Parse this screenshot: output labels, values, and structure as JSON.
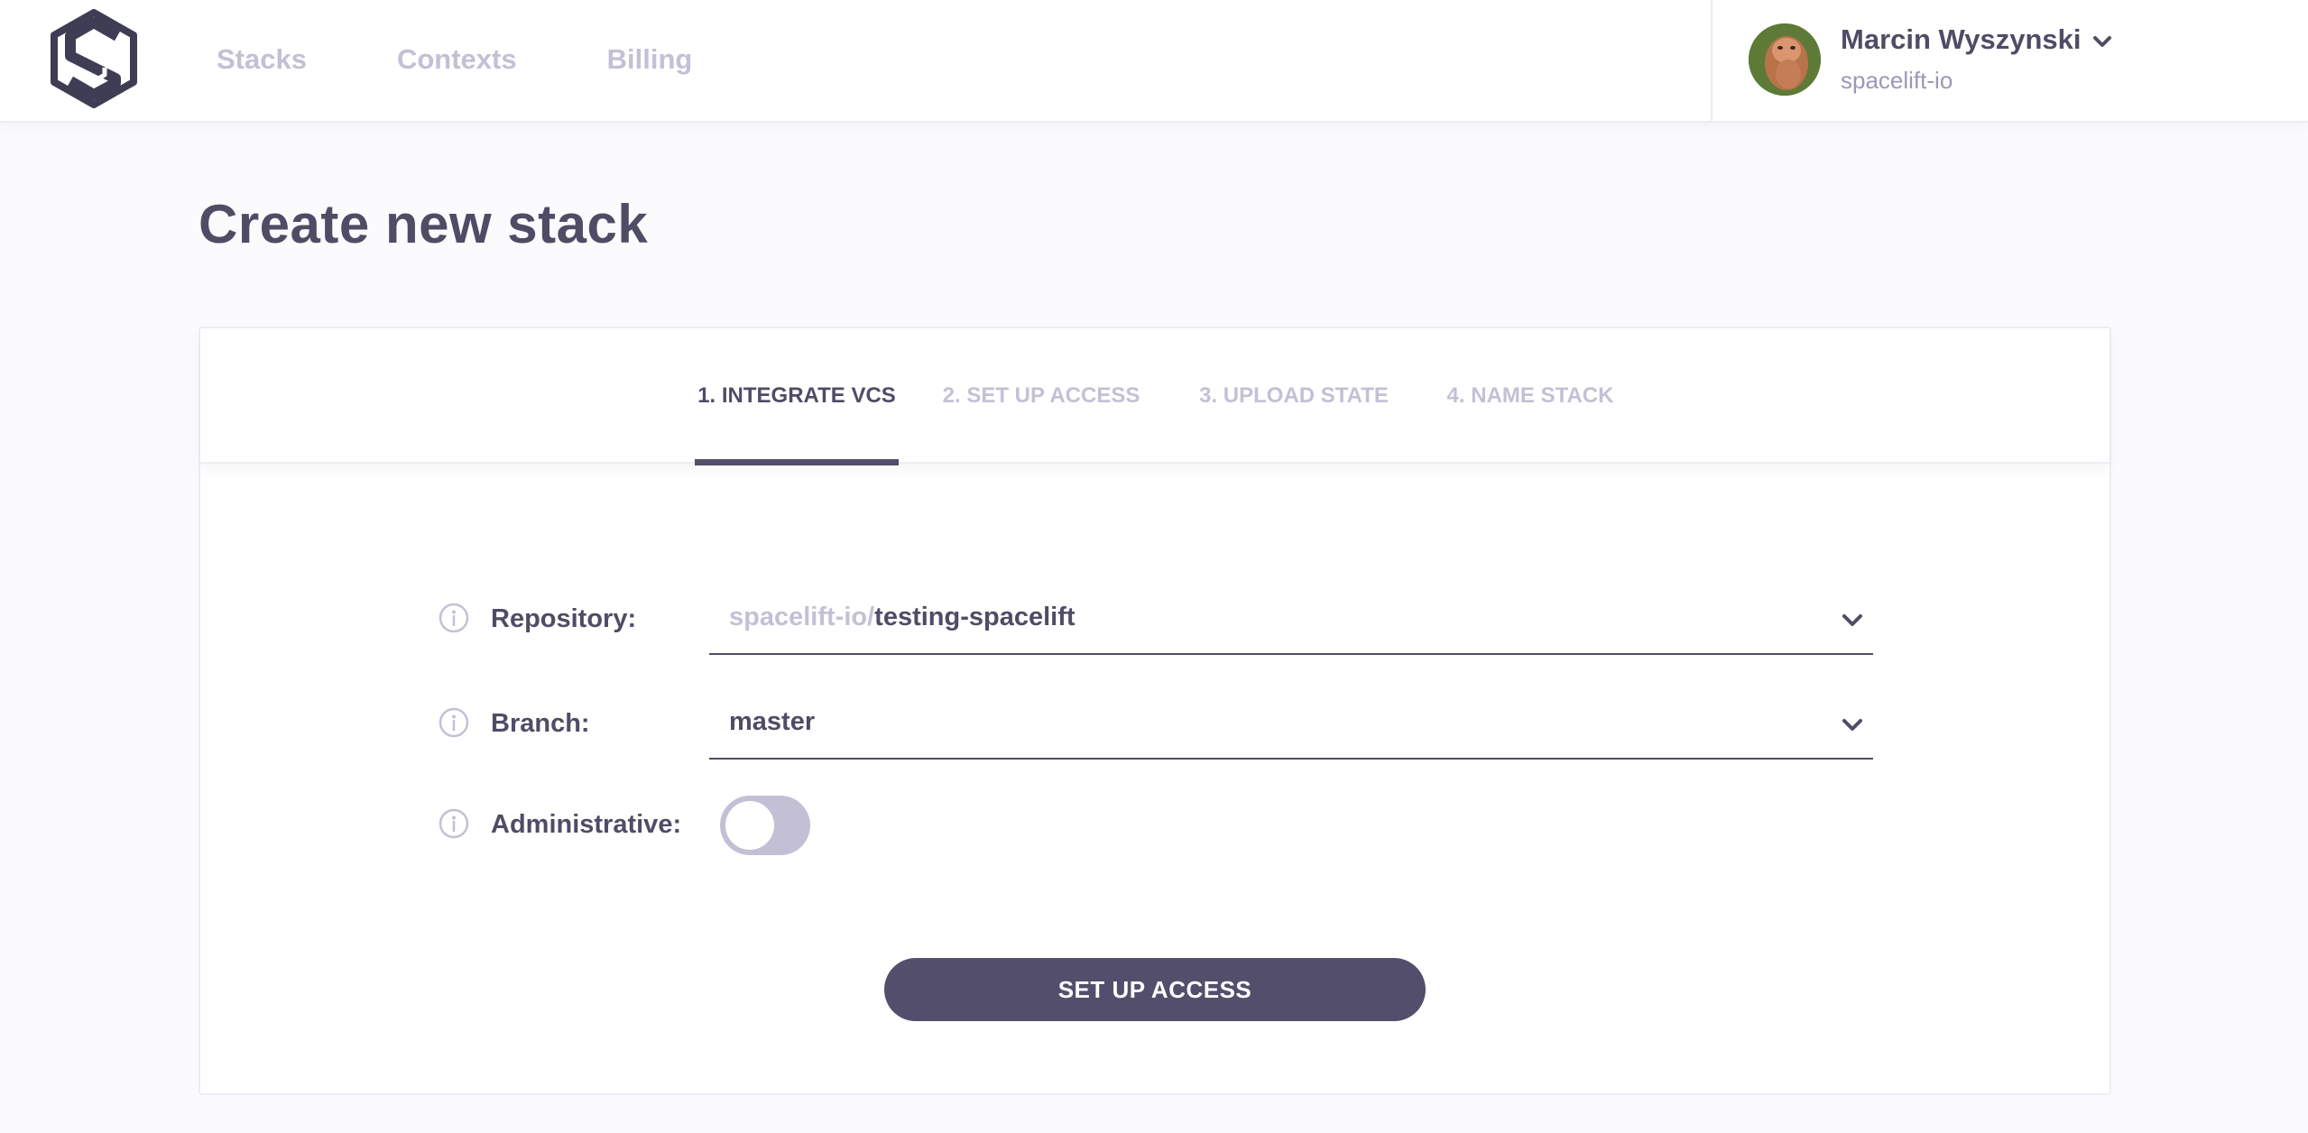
{
  "header": {
    "logo": "spacelift-logo",
    "nav": [
      {
        "label": "Stacks"
      },
      {
        "label": "Contexts"
      },
      {
        "label": "Billing"
      }
    ],
    "user": {
      "name": "Marcin Wyszynski",
      "org": "spacelift-io",
      "avatar": "avatar"
    }
  },
  "page": {
    "title": "Create new stack"
  },
  "wizard": {
    "steps": [
      {
        "label": "1. INTEGRATE VCS",
        "active": true
      },
      {
        "label": "2. SET UP ACCESS",
        "active": false
      },
      {
        "label": "3. UPLOAD STATE",
        "active": false
      },
      {
        "label": "4. NAME STACK",
        "active": false
      }
    ],
    "form": {
      "repository": {
        "label": "Repository:",
        "prefix": "spacelift-io/",
        "value": "testing-spacelift"
      },
      "branch": {
        "label": "Branch:",
        "value": "master"
      },
      "administrative": {
        "label": "Administrative:",
        "enabled": false
      }
    },
    "submit_label": "SET UP ACCESS"
  },
  "colors": {
    "accent": "#524e6b",
    "text": "#4f4c66",
    "muted": "#c3c0d6",
    "background": "#fbfbfd"
  }
}
